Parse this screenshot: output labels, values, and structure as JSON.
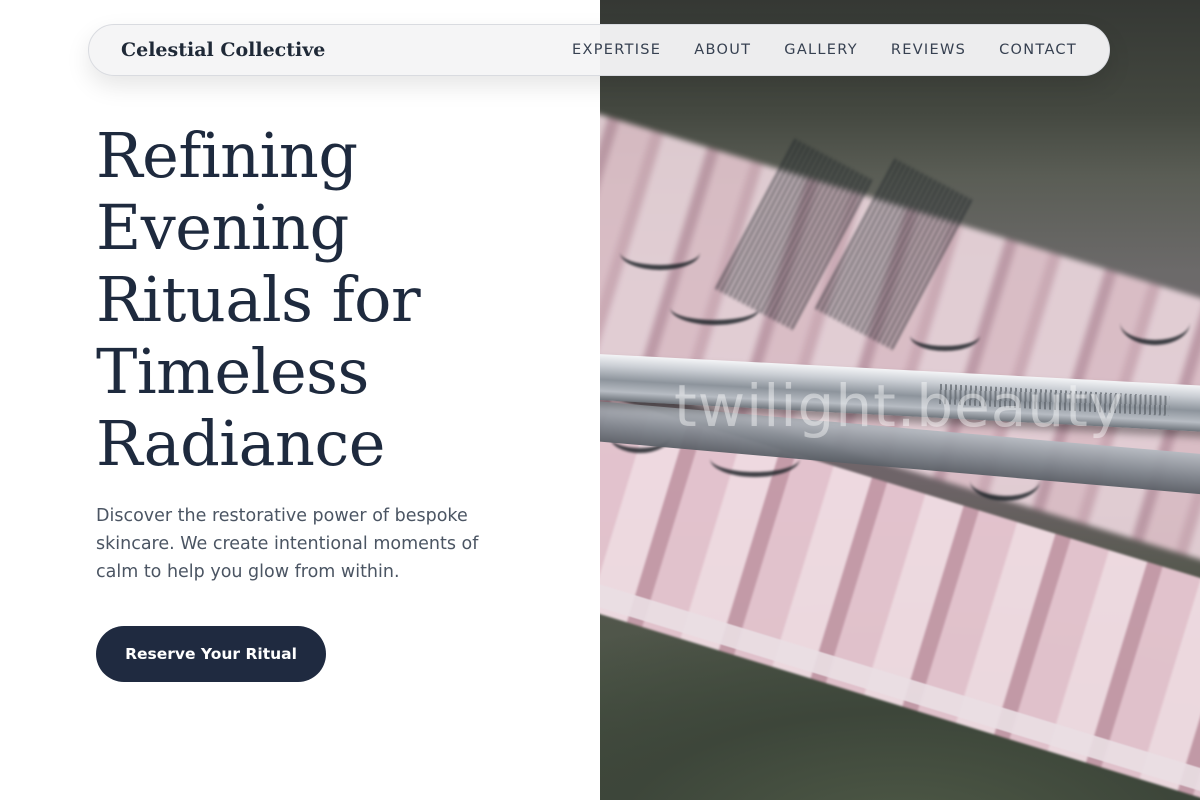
{
  "nav": {
    "brand": "Celestial Collective",
    "links": [
      "EXPERTISE",
      "ABOUT",
      "GALLERY",
      "REVIEWS",
      "CONTACT"
    ]
  },
  "hero": {
    "title": "Refining Evening Rituals for Timeless Radiance",
    "subtitle": "Discover the restorative power of bespoke skincare. We create intentional moments of calm to help you glow from within.",
    "cta_label": "Reserve Your Ritual"
  },
  "image": {
    "watermark": "twilight.beauty",
    "subject": "eyelash-extension-tray-with-tweezers"
  },
  "colors": {
    "primary": "#1f2a40",
    "heading": "#1e2a3e",
    "body_text": "#4b5563",
    "background": "#ffffff"
  }
}
